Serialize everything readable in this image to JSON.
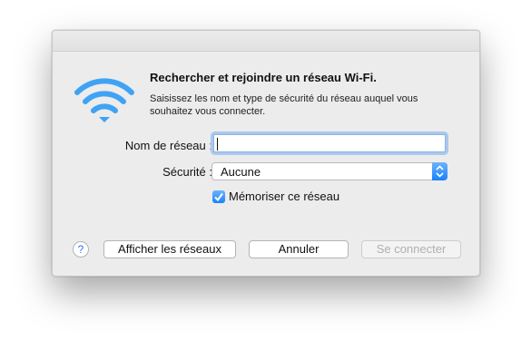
{
  "dialog": {
    "heading": "Rechercher et rejoindre un réseau Wi-Fi.",
    "subtext": "Saisissez les nom et type de sécurité du réseau auquel vous souhaitez vous connecter."
  },
  "form": {
    "network_label": "Nom de réseau :",
    "network_value": "",
    "security_label": "Sécurité :",
    "security_value": "Aucune",
    "remember_label": "Mémoriser ce réseau",
    "remember_checked": true
  },
  "buttons": {
    "help": "?",
    "show_networks": "Afficher les réseaux",
    "cancel": "Annuler",
    "connect": "Se connecter"
  },
  "colors": {
    "accent": "#1a82fb",
    "wifi": "#3fa3f5"
  },
  "icons": {
    "wifi": "wifi-icon",
    "help": "help-icon",
    "select_arrows": "up-down-chevron-icon",
    "checkmark": "checkmark-icon"
  }
}
